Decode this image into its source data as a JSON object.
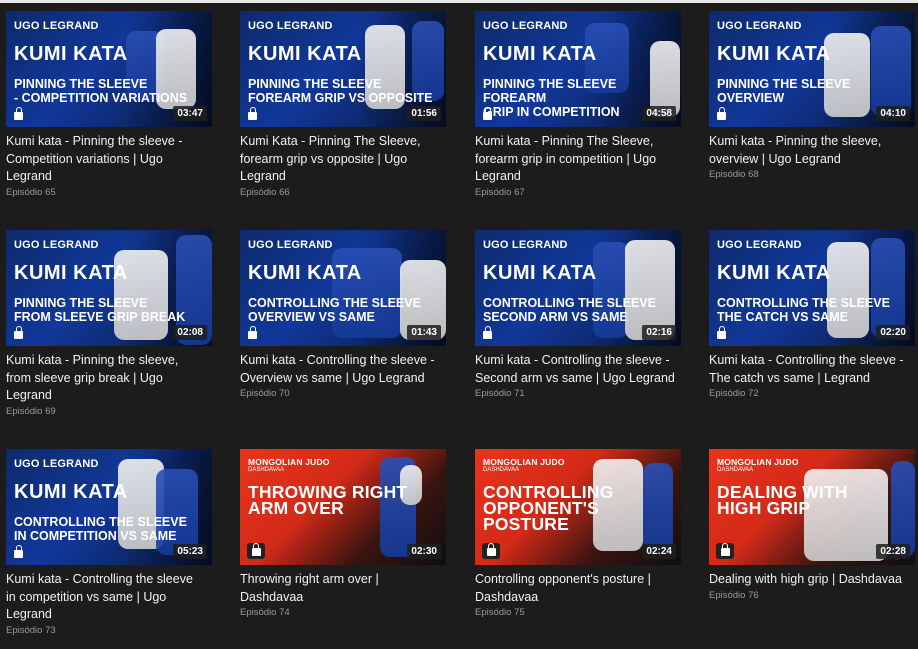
{
  "colors": {
    "background": "#1c1c1c",
    "brand_blue": "#11389a",
    "brand_red": "#e8341c",
    "episode_text": "#9a9a9a"
  },
  "icons": {
    "lock": "lock-icon"
  },
  "videos": [
    {
      "style": "blue",
      "brand": "UGO LEGRAND",
      "heading": "KUMI KATA",
      "overlay_line1": "PINNING THE SLEEVE",
      "overlay_line2": "- COMPETITION VARIATIONS",
      "duration": "03:47",
      "title": "Kumi kata - Pinning the sleeve - Competition variations | Ugo Legrand",
      "episode": "Episódio 65"
    },
    {
      "style": "blue",
      "brand": "UGO LEGRAND",
      "heading": "KUMI KATA",
      "overlay_line1": "PINNING THE SLEEVE",
      "overlay_line2": "FOREARM GRIP VS OPPOSITE",
      "duration": "01:56",
      "title": "Kumi Kata - Pinning The Sleeve, forearm grip vs opposite | Ugo Legrand",
      "episode": "Episódio 66"
    },
    {
      "style": "blue",
      "brand": "UGO LEGRAND",
      "heading": "KUMI KATA",
      "overlay_line1": "PINNING THE SLEEVE FOREARM",
      "overlay_line2": "GRIP IN COMPETITION",
      "duration": "04:58",
      "title": "Kumi kata - Pinning The Sleeve, forearm grip in competition | Ugo Legrand",
      "episode": "Episódio 67"
    },
    {
      "style": "blue",
      "brand": "UGO LEGRAND",
      "heading": "KUMI KATA",
      "overlay_line1": "PINNING THE SLEEVE",
      "overlay_line2": "OVERVIEW",
      "duration": "04:10",
      "title": "Kumi kata - Pinning the sleeve, overview | Ugo Legrand",
      "episode": "Episódio 68"
    },
    {
      "style": "blue",
      "brand": "UGO LEGRAND",
      "heading": "KUMI KATA",
      "overlay_line1": "PINNING THE SLEEVE",
      "overlay_line2": "FROM SLEEVE GRIP BREAK",
      "duration": "02:08",
      "title": "Kumi kata - Pinning the sleeve, from sleeve grip break | Ugo Legrand",
      "episode": "Episódio 69"
    },
    {
      "style": "blue",
      "brand": "UGO LEGRAND",
      "heading": "KUMI KATA",
      "overlay_line1": "CONTROLLING THE SLEEVE",
      "overlay_line2": "OVERVIEW VS SAME",
      "duration": "01:43",
      "title": "Kumi kata - Controlling the sleeve - Overview vs same | Ugo Legrand",
      "episode": "Episódio 70"
    },
    {
      "style": "blue",
      "brand": "UGO LEGRAND",
      "heading": "KUMI KATA",
      "overlay_line1": "CONTROLLING THE SLEEVE",
      "overlay_line2": "SECOND ARM VS SAME",
      "duration": "02:16",
      "title": "Kumi kata - Controlling the sleeve - Second arm vs same | Ugo Legrand",
      "episode": "Episódio 71"
    },
    {
      "style": "blue",
      "brand": "UGO LEGRAND",
      "heading": "KUMI KATA",
      "overlay_line1": "CONTROLLING THE SLEEVE",
      "overlay_line2": "THE CATCH VS SAME",
      "duration": "02:20",
      "title": "Kumi kata - Controlling the sleeve - The catch vs same | Legrand",
      "episode": "Episódio 72"
    },
    {
      "style": "blue",
      "brand": "UGO LEGRAND",
      "heading": "KUMI KATA",
      "overlay_line1": "CONTROLLING THE SLEEVE",
      "overlay_line2": "IN COMPETITION VS SAME",
      "duration": "05:23",
      "title": "Kumi kata - Controlling the sleeve in competition vs same | Ugo Legrand",
      "episode": "Episódio 73"
    },
    {
      "style": "red",
      "brand": "MONGOLIAN JUDO",
      "brand_sub": "DASHDAVAA",
      "heading": "",
      "overlay_line1": "THROWING RIGHT",
      "overlay_line2": "ARM OVER",
      "duration": "02:30",
      "title": "Throwing right arm over | Dashdavaa",
      "episode": "Episódio 74"
    },
    {
      "style": "red",
      "brand": "MONGOLIAN JUDO",
      "brand_sub": "DASHDAVAA",
      "heading": "",
      "overlay_line1": "CONTROLLING",
      "overlay_line2": "OPPONENT'S POSTURE",
      "duration": "02:24",
      "title": "Controlling opponent's posture | Dashdavaa",
      "episode": "Episódio 75"
    },
    {
      "style": "red",
      "brand": "MONGOLIAN JUDO",
      "brand_sub": "DASHDAVAA",
      "heading": "",
      "overlay_line1": "DEALING WITH",
      "overlay_line2": "HIGH GRIP",
      "duration": "02:28",
      "title": "Dealing with high grip | Dashdavaa",
      "episode": "Episódio 76"
    }
  ]
}
